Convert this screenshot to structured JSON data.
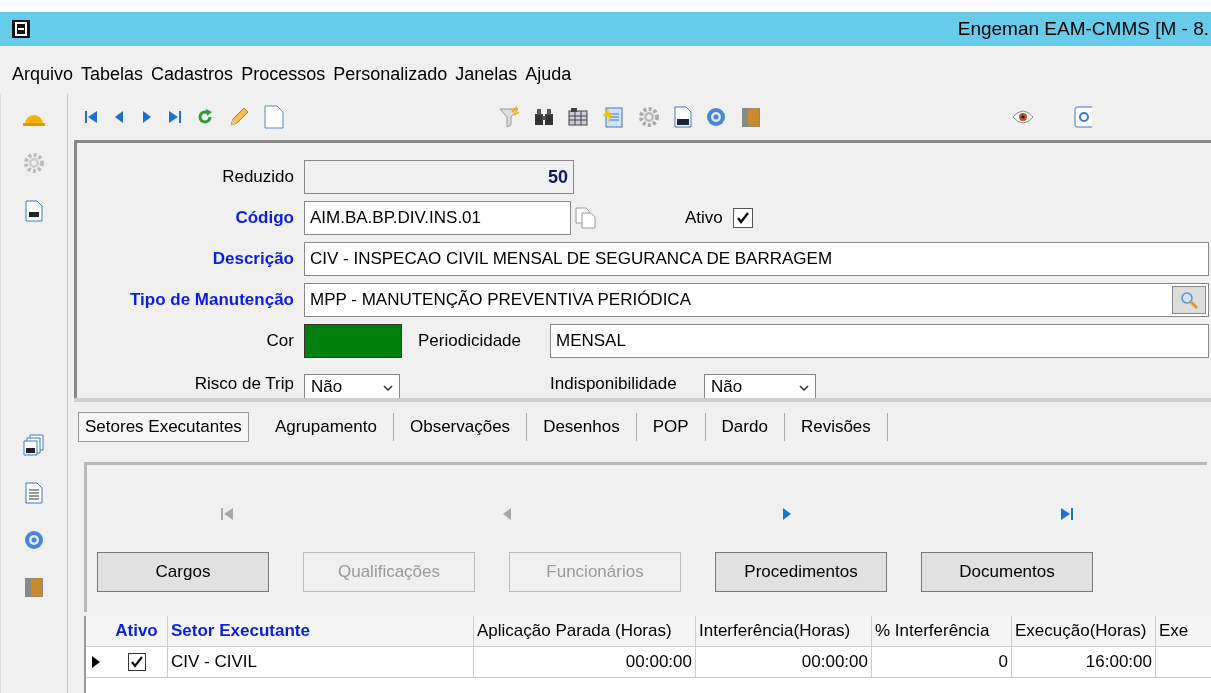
{
  "window": {
    "title": "Engeman EAM-CMMS [M - 8."
  },
  "menu": [
    "Arquivo",
    "Tabelas",
    "Cadastros",
    "Processos",
    "Personalizado",
    "Janelas",
    "Ajuda"
  ],
  "form": {
    "reduzido": {
      "label": "Reduzido",
      "value": "50"
    },
    "codigo": {
      "label": "Código",
      "required": true,
      "value": "AIM.BA.BP.DIV.INS.01"
    },
    "ativo": {
      "label": "Ativo",
      "checked": true
    },
    "descricao": {
      "label": "Descrição",
      "required": true,
      "value": "CIV - INSPECAO CIVIL MENSAL DE SEGURANCA DE BARRAGEM"
    },
    "tipo": {
      "label": "Tipo de Manutenção",
      "required": true,
      "value": "MPP - MANUTENÇÃO PREVENTIVA PERIÓDICA"
    },
    "cor": {
      "label": "Cor",
      "color": "#007f0e"
    },
    "periodicidade": {
      "label": "Periodicidade",
      "value": "MENSAL"
    },
    "risco": {
      "label": "Risco de Trip",
      "value": "Não"
    },
    "indisponibilidade": {
      "label": "Indisponibilidade",
      "value": "Não"
    }
  },
  "tabs": [
    {
      "label": "Setores Executantes",
      "selected": true
    },
    {
      "label": "Agrupamento",
      "selected": false
    },
    {
      "label": "Observações",
      "selected": false
    },
    {
      "label": "Desenhos",
      "selected": false
    },
    {
      "label": "POP",
      "selected": false
    },
    {
      "label": "Dardo",
      "selected": false
    },
    {
      "label": "Revisões",
      "selected": false
    }
  ],
  "record_nav": [
    {
      "kind": "first",
      "disabled": true
    },
    {
      "kind": "previous",
      "disabled": true
    },
    {
      "kind": "next",
      "disabled": false
    },
    {
      "kind": "last",
      "disabled": false
    }
  ],
  "buttons": [
    {
      "label": "Cargos",
      "disabled": false
    },
    {
      "label": "Qualificações",
      "disabled": true
    },
    {
      "label": "Funcionários",
      "disabled": true
    },
    {
      "label": "Procedimentos",
      "disabled": false
    },
    {
      "label": "Documentos",
      "disabled": false
    }
  ],
  "table": {
    "columns": [
      {
        "label": "Ativo",
        "kind": "check",
        "required": true
      },
      {
        "label": "Setor Executante",
        "kind": "text",
        "required": true
      },
      {
        "label": "Aplicação Parada (Horas)",
        "kind": "num",
        "required": false
      },
      {
        "label": "Interferência(Horas)",
        "kind": "num",
        "required": false
      },
      {
        "label": "% Interferência",
        "kind": "num",
        "required": false
      },
      {
        "label": "Execução(Horas)",
        "kind": "num",
        "required": false
      },
      {
        "label": "Exe",
        "kind": "num",
        "required": false
      }
    ],
    "rows": [
      {
        "current": true,
        "cells": [
          {
            "checked": true
          },
          {
            "text": "CIV - CIVIL"
          },
          {
            "text": "00:00:00"
          },
          {
            "text": "00:00:00"
          },
          {
            "text": "0"
          },
          {
            "text": "16:00:00"
          }
        ]
      }
    ]
  }
}
